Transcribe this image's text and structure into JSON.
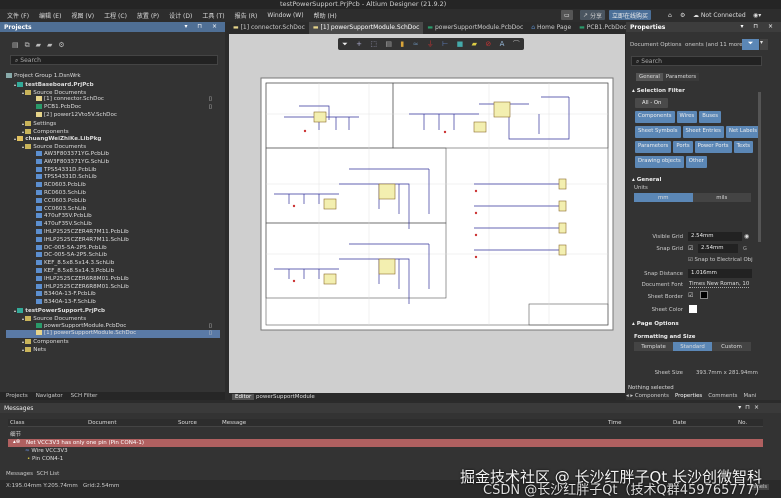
{
  "window": {
    "title": "testPowerSupport.PrjPcb - Altium Designer (21.9.2)"
  },
  "menu": [
    "文件 (F)",
    "编辑 (E)",
    "视图 (V)",
    "工程 (C)",
    "放置 (P)",
    "设计 (D)",
    "工具 (T)",
    "报告 (R)",
    "Window (W)",
    "帮助 (H)"
  ],
  "topright": {
    "share": "分享",
    "buy": "立即在线购买",
    "connection": "Not Connected"
  },
  "projects": {
    "title": "Projects",
    "search_placeholder": "Search",
    "tree": [
      {
        "label": "Project Group 1.DsnWrk",
        "level": 0,
        "icon": "workspace"
      },
      {
        "label": "testBaseboard.PrjPcb",
        "level": 1,
        "icon": "project",
        "bold": true
      },
      {
        "label": "Source Documents",
        "level": 2,
        "icon": "folder"
      },
      {
        "label": "[1] connector.SchDoc",
        "level": 3,
        "icon": "sch",
        "file": true
      },
      {
        "label": "PCB1.PcbDoc",
        "level": 3,
        "icon": "pcb",
        "file": true
      },
      {
        "label": "[2] power12Vto5V.SchDoc",
        "level": 3,
        "icon": "sch"
      },
      {
        "label": "Settings",
        "level": 2,
        "icon": "folder"
      },
      {
        "label": "Components",
        "level": 2,
        "icon": "folder"
      },
      {
        "label": "chuangWeiZhiKe.LibPkg",
        "level": 1,
        "icon": "libpkg",
        "bold": true
      },
      {
        "label": "Source Documents",
        "level": 2,
        "icon": "folder"
      },
      {
        "label": "AW3F803371YG.PcbLib",
        "level": 3,
        "icon": "lib"
      },
      {
        "label": "AW3F803371YG.SchLib",
        "level": 3,
        "icon": "lib"
      },
      {
        "label": "TPS54331D.PcbLib",
        "level": 3,
        "icon": "lib"
      },
      {
        "label": "TPS54331D.SchLib",
        "level": 3,
        "icon": "lib"
      },
      {
        "label": "RC0603.PcbLib",
        "level": 3,
        "icon": "lib"
      },
      {
        "label": "RC0603.SchLib",
        "level": 3,
        "icon": "lib"
      },
      {
        "label": "CC0603.PcbLib",
        "level": 3,
        "icon": "lib"
      },
      {
        "label": "CC0603.SchLib",
        "level": 3,
        "icon": "lib"
      },
      {
        "label": "470uF35V.PcbLib",
        "level": 3,
        "icon": "lib"
      },
      {
        "label": "470uF35V.SchLib",
        "level": 3,
        "icon": "lib"
      },
      {
        "label": "IHLP2525CZER4R7M11.PcbLib",
        "level": 3,
        "icon": "lib"
      },
      {
        "label": "IHLP2525CZER4R7M11.SchLib",
        "level": 3,
        "icon": "lib"
      },
      {
        "label": "DC-005-5A-2P5.PcbLib",
        "level": 3,
        "icon": "lib"
      },
      {
        "label": "DC-005-5A-2P5.SchLib",
        "level": 3,
        "icon": "lib"
      },
      {
        "label": "KEF_8.5x8.5x14.3.SchLib",
        "level": 3,
        "icon": "lib"
      },
      {
        "label": "KEF_8.5x8.5x14.3.PcbLib",
        "level": 3,
        "icon": "lib"
      },
      {
        "label": "IHLP2525CZER6R8M01.PcbLib",
        "level": 3,
        "icon": "lib"
      },
      {
        "label": "IHLP2525CZER6R8M01.SchLib",
        "level": 3,
        "icon": "lib"
      },
      {
        "label": "B340A-13-F.PcbLib",
        "level": 3,
        "icon": "lib"
      },
      {
        "label": "B340A-13-F.SchLib",
        "level": 3,
        "icon": "lib"
      },
      {
        "label": "testPowerSupport.PrjPcb",
        "level": 1,
        "icon": "project",
        "bold": true
      },
      {
        "label": "Source Documents",
        "level": 2,
        "icon": "folder"
      },
      {
        "label": "powerSupportModule.PcbDoc",
        "level": 3,
        "icon": "pcb",
        "file": true
      },
      {
        "label": "[1] powerSupportModule.SchDoc",
        "level": 3,
        "icon": "sch",
        "file": true,
        "selected": true
      },
      {
        "label": "Components",
        "level": 2,
        "icon": "folder"
      },
      {
        "label": "Nets",
        "level": 2,
        "icon": "folder"
      }
    ],
    "bottom_tabs": [
      "Projects",
      "Navigator",
      "SCH Filter"
    ]
  },
  "doc_tabs": [
    {
      "label": "[1] connector.SchDoc",
      "icon": "sch"
    },
    {
      "label": "[1] powerSupportModule.SchDoc",
      "icon": "sch",
      "active": true
    },
    {
      "label": "powerSupportModule.PcbDoc",
      "icon": "pcb"
    },
    {
      "label": "Home Page",
      "icon": "home"
    },
    {
      "label": "PCB1.PcbDoc",
      "icon": "pcb"
    }
  ],
  "editor_bar": {
    "tab": "Editor",
    "doc": "powerSupportModule"
  },
  "properties": {
    "title": "Properties",
    "doc_options": "Document Options",
    "filter_text": "onents (and 11 more)",
    "search_placeholder": "Search",
    "tabs": [
      "General",
      "Parameters"
    ],
    "selection_filter": {
      "title": "Selection Filter",
      "all": "All - On",
      "buttons": [
        "Components",
        "Wires",
        "Buses",
        "Sheet Symbols",
        "Sheet Entries",
        "Net Labels",
        "Parameters",
        "Ports",
        "Power Ports",
        "Texts",
        "Drawing objects",
        "Other"
      ]
    },
    "general": {
      "title": "General",
      "units_label": "Units",
      "units": [
        "mm",
        "mils"
      ],
      "visible_grid_label": "Visible Grid",
      "visible_grid": "2.54mm",
      "snap_grid_label": "Snap Grid",
      "snap_grid": "2.54mm",
      "snap_key": "G",
      "snap_electrical": "Snap to Electrical Obj",
      "snap_distance_label": "Snap Distance",
      "snap_distance": "1.016mm",
      "doc_font_label": "Document Font",
      "doc_font": "Times New Roman, 10",
      "sheet_border_label": "Sheet Border",
      "sheet_color_label": "Sheet Color"
    },
    "page_options": {
      "title": "Page Options",
      "fmt_label": "Formatting and Size",
      "modes": [
        "Template",
        "Standard",
        "Custom"
      ],
      "sheet_size_label": "Sheet Size",
      "sheet_size": "393.7mm x 281.94mm"
    },
    "nothing_selected": "Nothing selected",
    "bottom_tabs": [
      "Components",
      "Properties",
      "Comments",
      "Mani"
    ]
  },
  "messages": {
    "title": "Messages",
    "columns": [
      "Class",
      "Document",
      "Source",
      "Message",
      "Time",
      "Date",
      "No."
    ],
    "group": "细节",
    "error": "Net VCC3V3 has only one pin (Pin CON4-1)",
    "children": [
      "Wire VCC3V3",
      "Pin CON4-1"
    ],
    "bottom_tabs": [
      "Messages",
      "SCH List"
    ],
    "panels_btn": "Panels"
  },
  "status": {
    "coords": "X:195.04mm Y:205.74mm",
    "grid": "Grid:2.54mm"
  },
  "watermark": [
    "掘金技术社区 @ 长沙红胖子Qt  长沙创微智科",
    "CSDN @长沙红胖子Qt（技术Q群459765777）"
  ],
  "colors": {
    "accent": "#5b87b6",
    "error_row": "#b06060",
    "panel_header": "#4f6f95",
    "canvas": "#cfcfcf"
  }
}
